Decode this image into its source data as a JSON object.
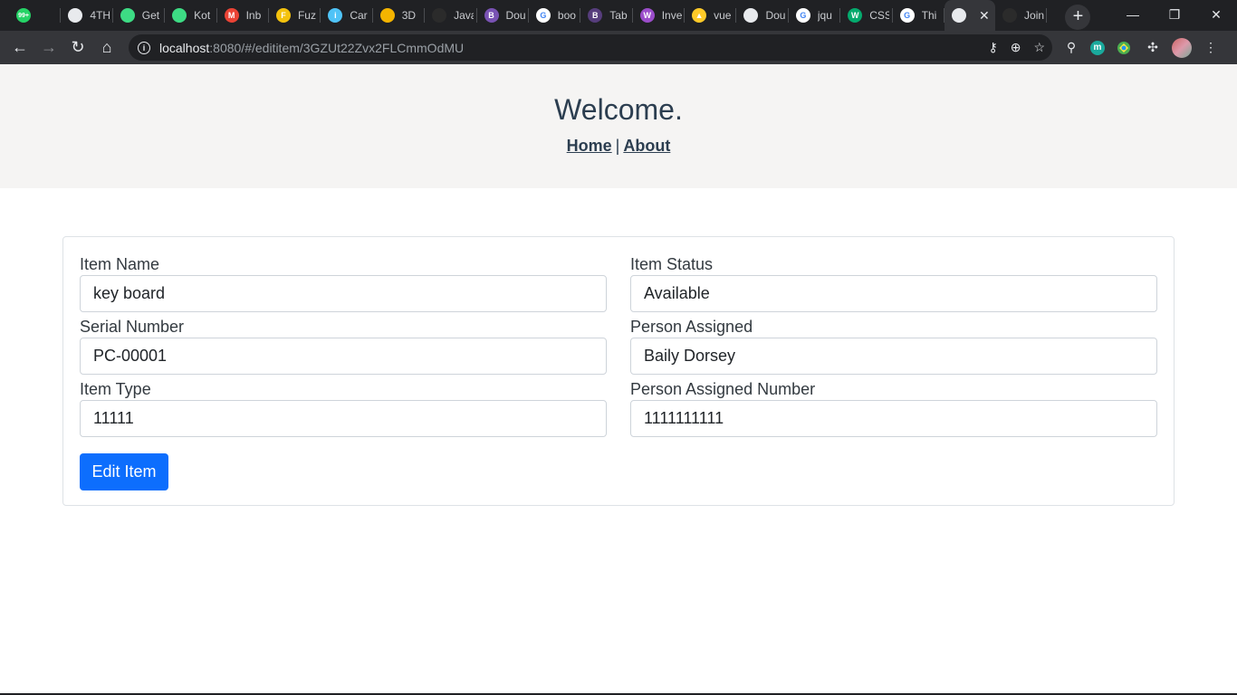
{
  "browser": {
    "tabs": [
      {
        "title": "",
        "favicon": "whatsapp-icon",
        "color": "#25d366",
        "badge": "99+"
      },
      {
        "title": "4TH",
        "favicon": "globe-icon",
        "color": "#e8eaed"
      },
      {
        "title": "Get",
        "favicon": "android-icon",
        "color": "#3ddc84"
      },
      {
        "title": "Kot",
        "favicon": "android-icon",
        "color": "#3ddc84"
      },
      {
        "title": "Inb",
        "favicon": "gmail-icon",
        "color": "#ea4335",
        "badge": "M"
      },
      {
        "title": "Fuz",
        "favicon": "fuzzy-icon",
        "color": "#f4c20d",
        "badge": "F"
      },
      {
        "title": "Car",
        "favicon": "info-icon",
        "color": "#4fc3f7",
        "badge": "i"
      },
      {
        "title": "3D",
        "favicon": "grid-icon",
        "color": "#f4b400"
      },
      {
        "title": "Java",
        "favicon": "github-icon",
        "color": "#2b2b2b"
      },
      {
        "title": "Dou",
        "favicon": "bootstrap-icon",
        "color": "#7952b3",
        "badge": "B"
      },
      {
        "title": "boo",
        "favicon": "google-icon",
        "color": "#ffffff",
        "badge": "G"
      },
      {
        "title": "Tab",
        "favicon": "bootstrap-icon",
        "color": "#563d7c",
        "badge": "B"
      },
      {
        "title": "Inve",
        "favicon": "w-icon",
        "color": "#9b4dca",
        "badge": "W"
      },
      {
        "title": "vue",
        "favicon": "firebase-icon",
        "color": "#ffca28",
        "badge": "▲"
      },
      {
        "title": "Dou",
        "favicon": "globe-icon",
        "color": "#e8eaed"
      },
      {
        "title": "jqu",
        "favicon": "google-icon",
        "color": "#ffffff",
        "badge": "G"
      },
      {
        "title": "CSS",
        "favicon": "w3-icon",
        "color": "#04aa6d",
        "badge": "W"
      },
      {
        "title": "Thi",
        "favicon": "google-icon",
        "color": "#ffffff",
        "badge": "G"
      },
      {
        "title": "",
        "favicon": "globe-icon",
        "color": "#e8eaed",
        "active": true
      },
      {
        "title": "Join",
        "favicon": "github-icon",
        "color": "#2b2b2b"
      }
    ],
    "newtab_symbol": "+",
    "window_controls": {
      "minimize": "—",
      "restore": "❐",
      "close": "✕"
    },
    "nav": {
      "back": "←",
      "forward": "→",
      "reload": "↻",
      "home": "⌂"
    },
    "url_host": "localhost",
    "url_rest": ":8080/#/edititem/3GZUt22Zvx2FLCmmOdMU",
    "omni_icons": {
      "key": "⚷",
      "zoom": "⊕",
      "star": "☆"
    },
    "extensions": {
      "location": "⚲",
      "m": "m",
      "puzzle": "✣",
      "menu": "⋮"
    }
  },
  "header": {
    "title": "Welcome.",
    "nav": {
      "home": "Home",
      "separator": "|",
      "about": "About"
    }
  },
  "form": {
    "left": [
      {
        "label": "Item Name",
        "value": "key board"
      },
      {
        "label": "Serial Number",
        "value": "PC-00001"
      },
      {
        "label": "Item Type",
        "value": "11111"
      }
    ],
    "right": [
      {
        "label": "Item Status",
        "value": "Available"
      },
      {
        "label": "Person Assigned",
        "value": "Baily Dorsey"
      },
      {
        "label": "Person Assigned Number",
        "value": "1111111111"
      }
    ],
    "submit_label": "Edit Item",
    "submit_color": "#0d6efd"
  }
}
